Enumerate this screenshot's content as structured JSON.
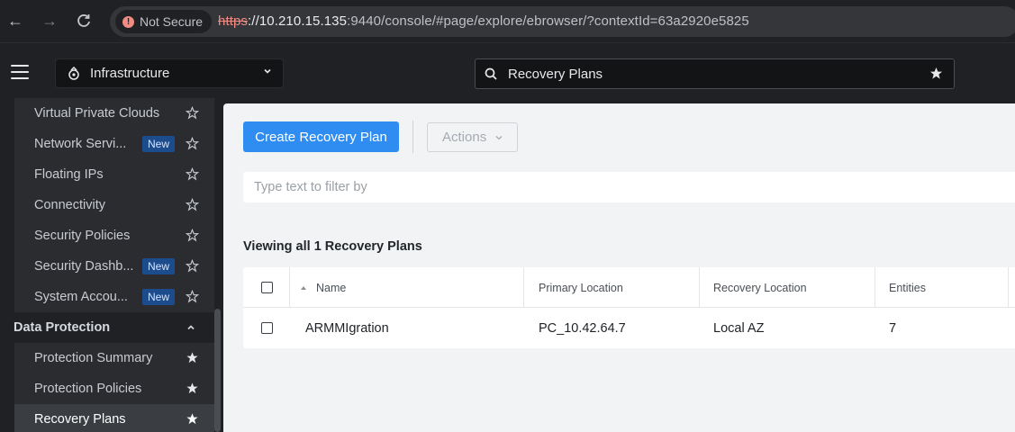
{
  "browser": {
    "back_icon": "arrow-left-icon",
    "forward_icon": "arrow-right-icon",
    "reload_icon": "reload-icon",
    "security_label": "Not Secure",
    "url_protocol": "https",
    "url_host": "://10.210.15.135",
    "url_path": ":9440/console/#page/explore/ebrowser/?contextId=63a2920e5825"
  },
  "header": {
    "menu_icon": "hamburger-menu-icon",
    "context_label": "Infrastructure",
    "search_value": "Recovery Plans"
  },
  "sidebar": {
    "items": [
      {
        "label": "Virtual Private Clouds",
        "badge": null,
        "starred": false
      },
      {
        "label": "Network Servi...",
        "badge": "New",
        "starred": false
      },
      {
        "label": "Floating IPs",
        "badge": null,
        "starred": false
      },
      {
        "label": "Connectivity",
        "badge": null,
        "starred": false
      },
      {
        "label": "Security Policies",
        "badge": null,
        "starred": false
      },
      {
        "label": "Security Dashb...",
        "badge": "New",
        "starred": false
      },
      {
        "label": "System Accou...",
        "badge": "New",
        "starred": false
      }
    ],
    "section": {
      "label": "Data Protection",
      "expanded": true
    },
    "section_items": [
      {
        "label": "Protection Summary",
        "starred": true
      },
      {
        "label": "Protection Policies",
        "starred": true
      },
      {
        "label": "Recovery Plans",
        "starred": true,
        "active": true
      }
    ]
  },
  "main": {
    "create_button": "Create Recovery Plan",
    "actions_button": "Actions",
    "filter_placeholder": "Type text to filter by",
    "viewing_text": "Viewing all 1 Recovery Plans",
    "table": {
      "columns": [
        "Name",
        "Primary Location",
        "Recovery Location",
        "Entities"
      ],
      "sorted_column": "Name",
      "rows": [
        {
          "name": "ARMMIgration",
          "primary_location": "PC_10.42.64.7",
          "recovery_location": "Local AZ",
          "entities": "7"
        }
      ]
    }
  },
  "colors": {
    "primary_button": "#2f8cf0",
    "new_badge": "#1c4c8c",
    "sidebar_bg": "#2a2c30",
    "active_item": "#3a3d42"
  }
}
